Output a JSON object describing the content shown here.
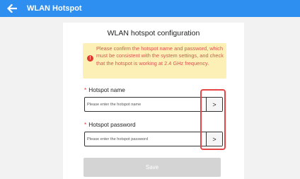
{
  "header": {
    "title": "WLAN Hotspot",
    "back_icon": "arrow-left-icon",
    "color": "#2f8ff0"
  },
  "card": {
    "title": "WLAN hotspot configuration",
    "warning": {
      "icon": "exclamation-circle-icon",
      "text": "Please confirm the hotspot name and password, which must be consistent with the system settings, and check that the hotspot is working at 2.4 GHz frequency."
    },
    "name_field": {
      "required_mark": "*",
      "label": "Hotspot name",
      "placeholder": "Please enter the hotspot name",
      "value": "",
      "button_label": ">"
    },
    "password_field": {
      "required_mark": "*",
      "label": "Hotspot password",
      "placeholder": "Please enter the hotspot password",
      "value": "",
      "button_label": ">"
    },
    "save_label": "Save"
  },
  "annotation": {
    "color": "#e64545"
  }
}
